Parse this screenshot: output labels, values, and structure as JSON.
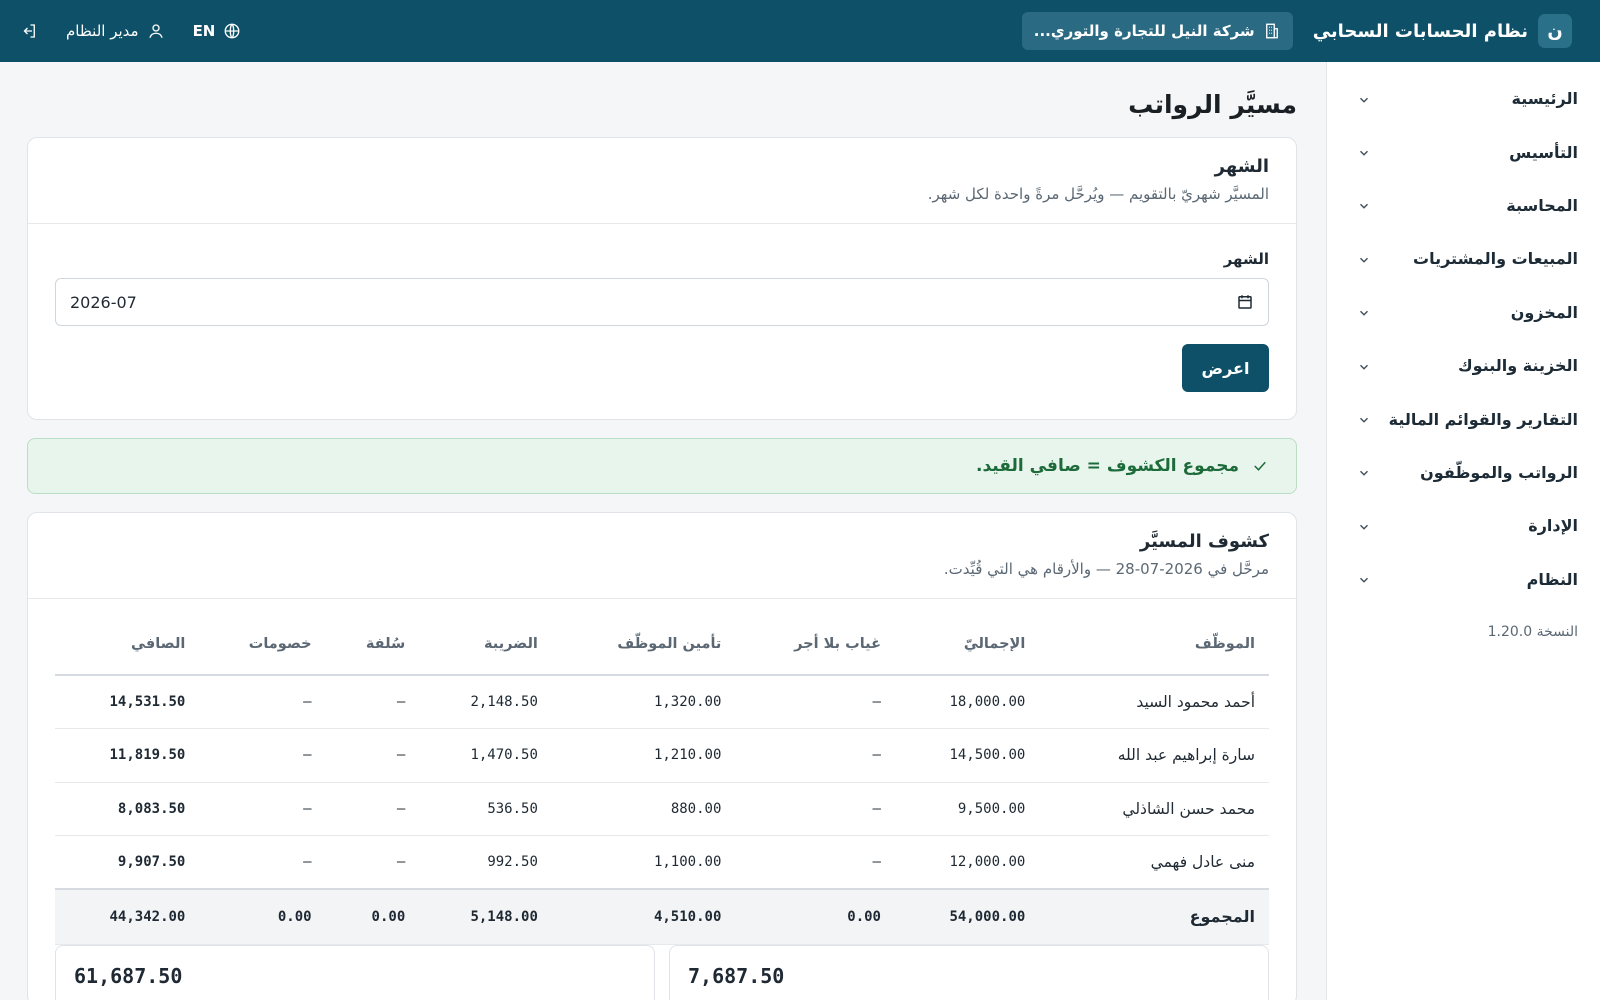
{
  "topbar": {
    "brand_letter": "ن",
    "brand_title": "نظام الحسابات السحابي",
    "company": "شركة النيل للتجارة والتوري...",
    "user": "مدير النظام",
    "lang": "EN",
    "icons": [
      "building-icon",
      "user-icon",
      "globe-icon",
      "logout-icon"
    ]
  },
  "sidebar": {
    "items": [
      {
        "label": "الرئيسية"
      },
      {
        "label": "التأسيس"
      },
      {
        "label": "المحاسبة"
      },
      {
        "label": "المبيعات والمشتريات"
      },
      {
        "label": "المخزون"
      },
      {
        "label": "الخزينة والبنوك"
      },
      {
        "label": "التقارير والقوائم المالية"
      },
      {
        "label": "الرواتب والموظّفون"
      },
      {
        "label": "الإدارة"
      },
      {
        "label": "النظام"
      }
    ],
    "version": "النسخة 1.20.0"
  },
  "page": {
    "title": "مسيَّر الرواتب"
  },
  "month_card": {
    "title": "الشهر",
    "subtitle": "المسيَّر شهريّ بالتقويم — ويُرحَّل مرةً واحدة لكل شهر.",
    "field_label": "الشهر",
    "month_value": "2026-07",
    "show_button": "اعرض"
  },
  "alert": {
    "text": "مجموع الكشوف = صافي القيد."
  },
  "payslips": {
    "title": "كشوف المسيَّر",
    "subtitle": "مرحَّل في 2026-07-28 — والأرقام هي التي قُيِّدت.",
    "columns": [
      "الموظّف",
      "الإجماليّ",
      "غياب بلا أجر",
      "تأمين الموظّف",
      "الضريبة",
      "سُلفة",
      "خصومات",
      "الصافي"
    ],
    "rows": [
      [
        "أحمد محمود السيد",
        "18,000.00",
        "–",
        "1,320.00",
        "2,148.50",
        "–",
        "–",
        "14,531.50"
      ],
      [
        "سارة إبراهيم عبد الله",
        "14,500.00",
        "–",
        "1,210.00",
        "1,470.50",
        "–",
        "–",
        "11,819.50"
      ],
      [
        "محمد حسن الشاذلي",
        "9,500.00",
        "–",
        "880.00",
        "536.50",
        "–",
        "–",
        "8,083.50"
      ],
      [
        "منى عادل فهمي",
        "12,000.00",
        "–",
        "1,100.00",
        "992.50",
        "–",
        "–",
        "9,907.50"
      ]
    ],
    "total": [
      "المجموع",
      "54,000.00",
      "0.00",
      "4,510.00",
      "5,148.00",
      "0.00",
      "0.00",
      "44,342.00"
    ],
    "summary_boxes": [
      "61,687.50",
      "7,687.50"
    ]
  },
  "colors": {
    "topbar": "#0e5068",
    "primary_button": "#0e5068",
    "success_text": "#1d6b3a",
    "success_bg": "#e8f5ec"
  }
}
